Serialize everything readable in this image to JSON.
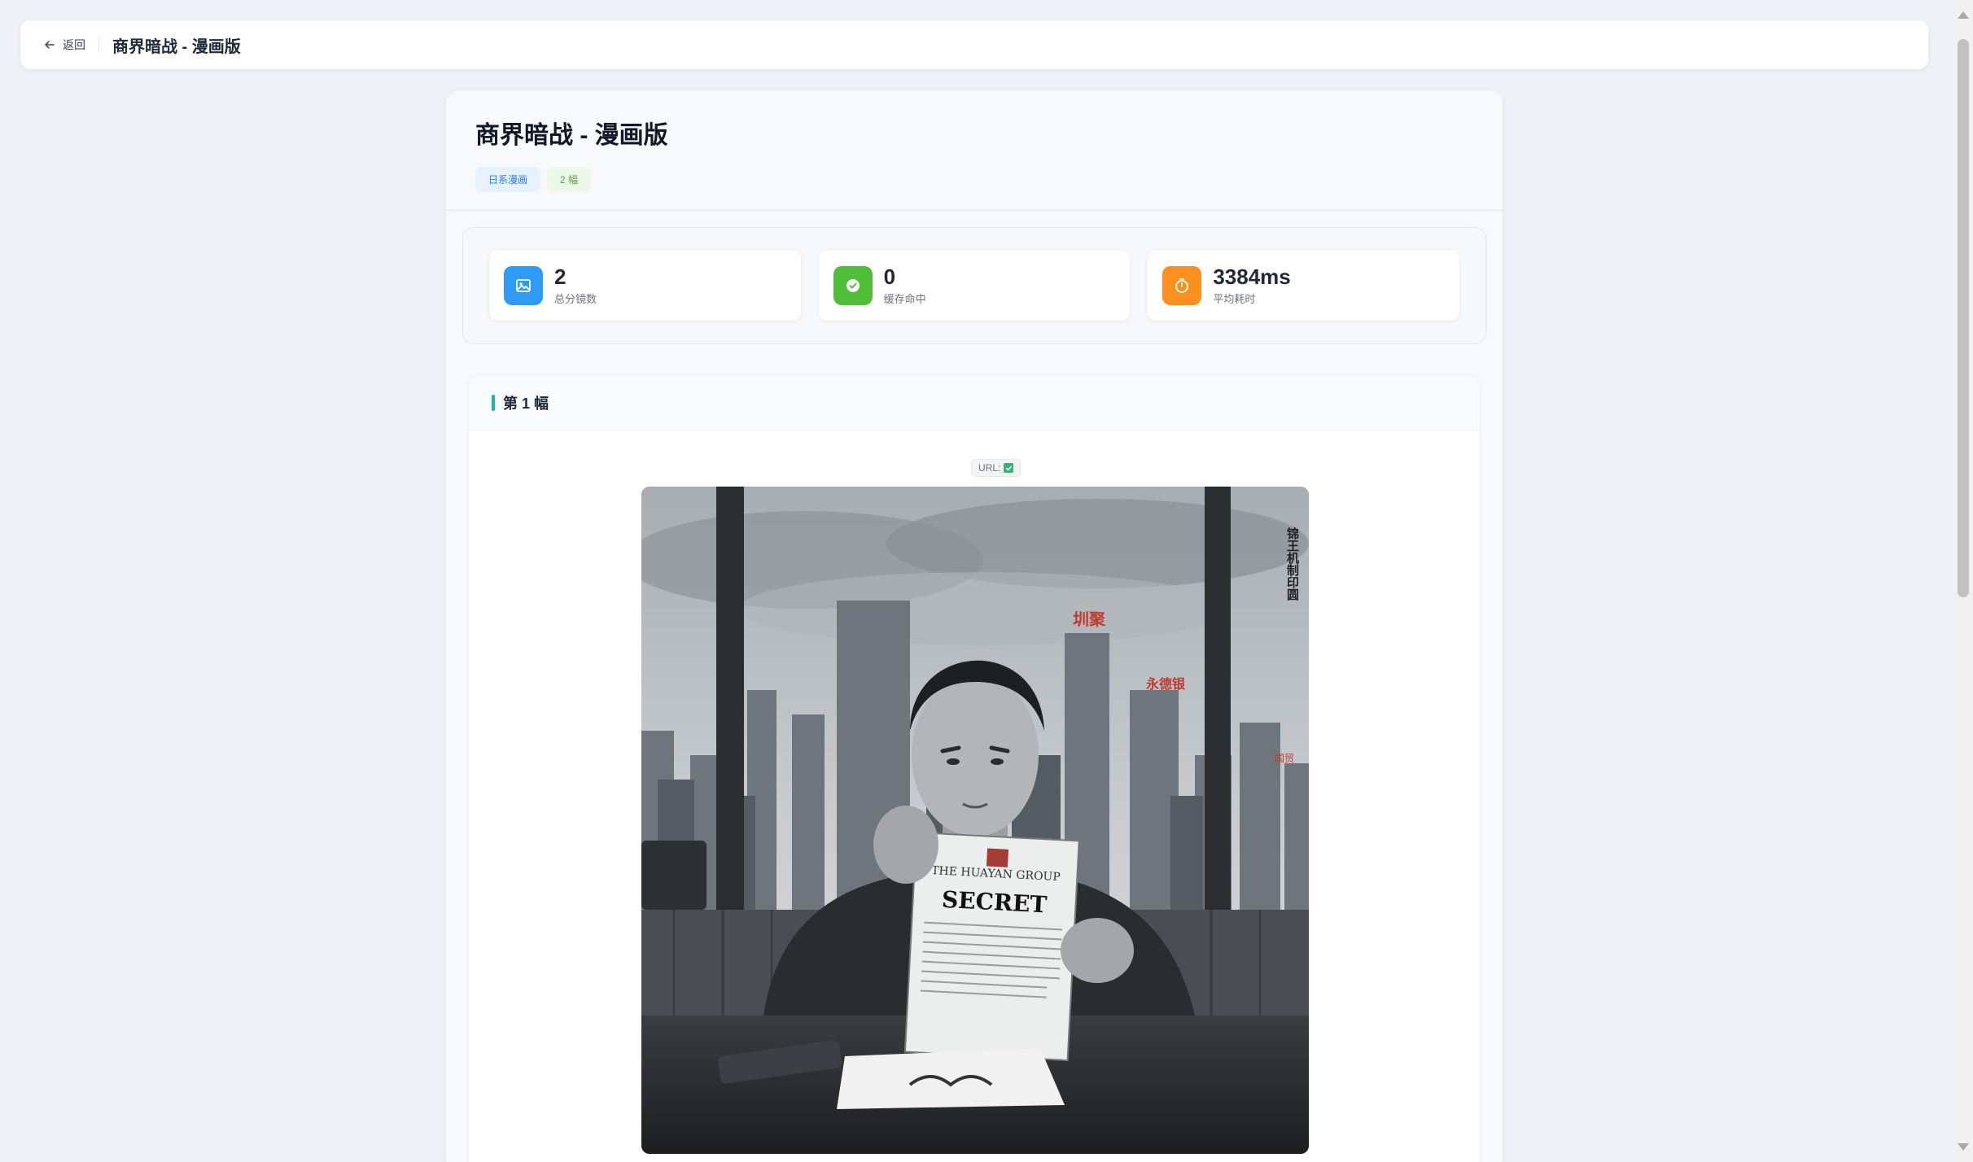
{
  "header": {
    "back_label": "返回",
    "title": "商界暗战 - 漫画版"
  },
  "main": {
    "title": "商界暗战 - 漫画版",
    "tags": [
      "日系漫画",
      "2 幅"
    ]
  },
  "stats": [
    {
      "value": "2",
      "label": "总分镜数",
      "icon": "image-icon",
      "color": "#2f9bf7"
    },
    {
      "value": "0",
      "label": "缓存命中",
      "icon": "check-circle-icon",
      "color": "#4fbf3a"
    },
    {
      "value": "3384ms",
      "label": "平均耗时",
      "icon": "stopwatch-icon",
      "color": "#fb8f1f"
    }
  ],
  "panel": {
    "title": "第 1 幅",
    "url_label": "URL:",
    "image": {
      "document_brand": "THE HUAYAN GROUP",
      "document_word": "SECRET",
      "vertical_text": "锦王机制印圆",
      "sign_text_1": "圳聚",
      "sign_text_2": "永德银",
      "sign_text_3": "国贸"
    }
  }
}
